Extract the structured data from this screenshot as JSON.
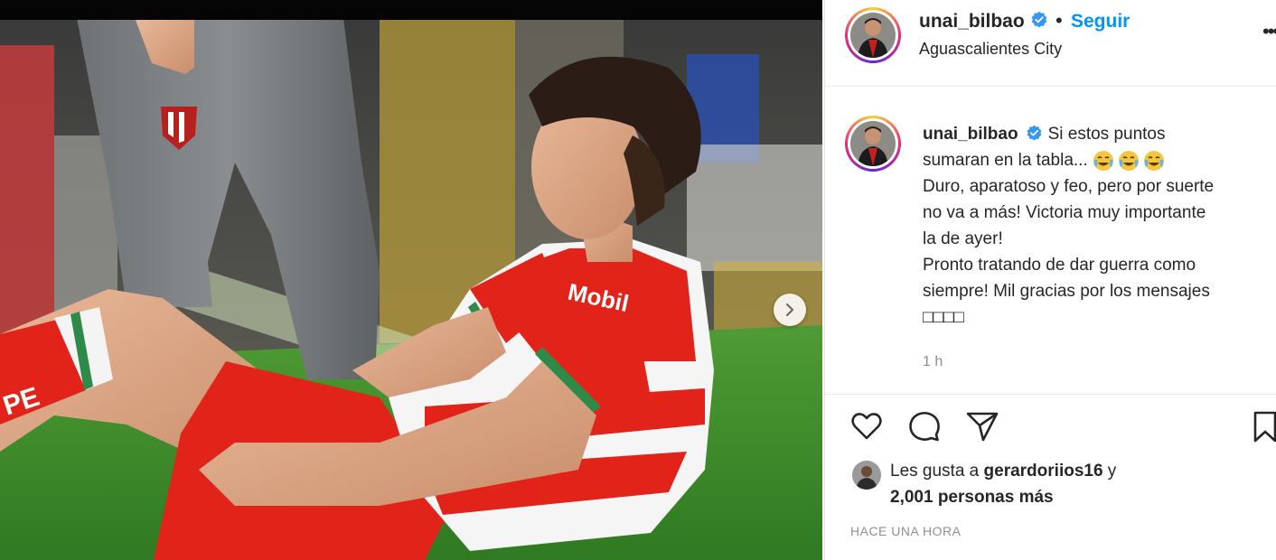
{
  "post": {
    "username": "unai_bilbao",
    "follow_label": "Seguir",
    "separator": "•",
    "location": "Aguascalientes City",
    "more_label": "•••"
  },
  "caption": {
    "username": "unai_bilbao",
    "line1": "Si estos puntos",
    "line2": "sumaran en la tabla...",
    "emoji_count": 3,
    "line3": "Duro, aparatoso y feo, pero por suerte",
    "line4": "no va a más! Victoria muy importante",
    "line5": "la de ayer!",
    "line6": "Pronto tratando de dar guerra como",
    "line7": "siempre! Mil gracias por los mensajes",
    "line8": "□□□□",
    "time": "1 h"
  },
  "likes": {
    "prefix": "Les gusta a ",
    "user": "gerardoriios16",
    "suffix": " y",
    "others": "2,001 personas más"
  },
  "post_age": "HACE UNA HORA",
  "photo": {
    "shirt_text": "Mobil",
    "sock_text": "PE"
  },
  "colors": {
    "link_blue": "#0095f6",
    "verified_blue": "#3897f0",
    "jersey_red": "#e2231a",
    "pitch_green": "#3f8a2a"
  }
}
